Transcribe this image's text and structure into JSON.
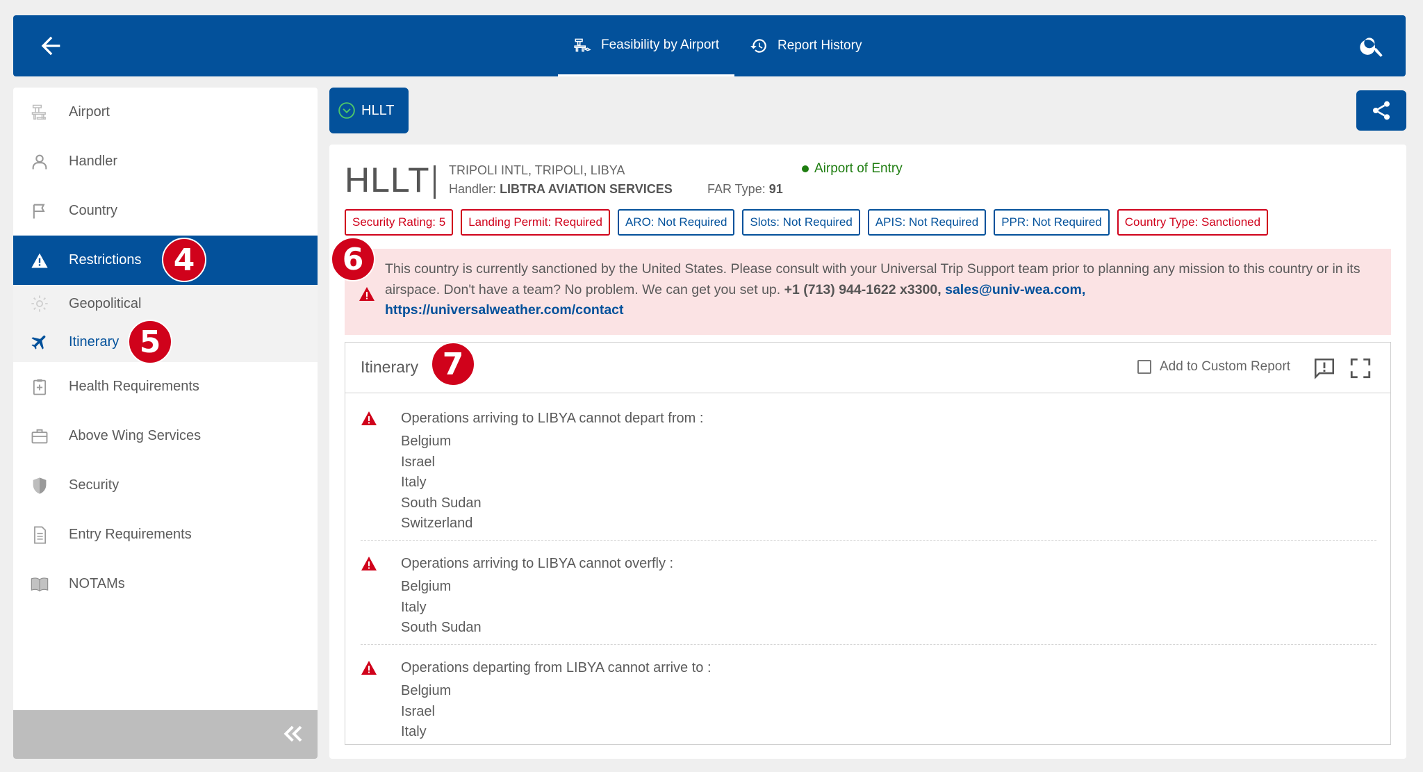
{
  "header": {
    "tabs": [
      {
        "label": "Feasibility by Airport",
        "icon": "airport-tower-icon",
        "active": true
      },
      {
        "label": "Report History",
        "icon": "history-icon",
        "active": false
      }
    ]
  },
  "sidebar": {
    "items": [
      {
        "label": "Airport",
        "icon": "airport-icon"
      },
      {
        "label": "Handler",
        "icon": "person-icon"
      },
      {
        "label": "Country",
        "icon": "flag-icon"
      },
      {
        "label": "Restrictions",
        "icon": "warning-icon",
        "active": true
      },
      {
        "label": "Geopolitical",
        "icon": "gear-icon"
      },
      {
        "label": "Itinerary",
        "icon": "airplane-icon",
        "selected": true
      },
      {
        "label": "Health Requirements",
        "icon": "clipboard-plus-icon"
      },
      {
        "label": "Above Wing Services",
        "icon": "briefcase-icon"
      },
      {
        "label": "Security",
        "icon": "shield-icon"
      },
      {
        "label": "Entry Requirements",
        "icon": "document-icon"
      },
      {
        "label": "NOTAMs",
        "icon": "book-icon"
      }
    ]
  },
  "markers": {
    "m4": "4",
    "m5": "5",
    "m6": "6",
    "m7": "7"
  },
  "airport_chip": {
    "label": "HLLT"
  },
  "airport": {
    "code": "HLLT",
    "name": "TRIPOLI INTL, TRIPOLI, LIBYA",
    "handler_label": "Handler:",
    "handler_value": "LIBTRA AVIATION SERVICES",
    "far_label": "FAR Type:",
    "far_value": "91",
    "entry_status": "Airport of Entry",
    "entry_color": "#1e7d10"
  },
  "badges": [
    {
      "label": "Security Rating: 5",
      "tone": "red"
    },
    {
      "label": "Landing Permit: Required",
      "tone": "red"
    },
    {
      "label": "ARO: Not Required",
      "tone": "blue"
    },
    {
      "label": "Slots: Not Required",
      "tone": "blue"
    },
    {
      "label": "APIS: Not Required",
      "tone": "blue"
    },
    {
      "label": "PPR: Not Required",
      "tone": "blue"
    },
    {
      "label": "Country Type: Sanctioned",
      "tone": "red"
    }
  ],
  "alert": {
    "text": "This country is currently sanctioned by the United States. Please consult with your Universal Trip Support team prior to planning any mission to this country or in its airspace. Don't have a team? No problem. We can get you set up.",
    "phone": "+1 (713) 944-1622 x3300,",
    "email": "sales@univ-wea.com,",
    "url": "https://universalweather.com/contact"
  },
  "itinerary": {
    "title": "Itinerary",
    "custom_report_label": "Add to Custom Report",
    "restrictions": [
      {
        "heading": "Operations arriving to LIBYA cannot depart from :",
        "countries": [
          "Belgium",
          "Israel",
          "Italy",
          "South Sudan",
          "Switzerland"
        ]
      },
      {
        "heading": "Operations arriving to LIBYA cannot overfly :",
        "countries": [
          "Belgium",
          "Italy",
          "South Sudan"
        ]
      },
      {
        "heading": "Operations departing from LIBYA cannot arrive to :",
        "countries": [
          "Belgium",
          "Israel",
          "Italy"
        ]
      }
    ]
  },
  "colors": {
    "primary": "#03519b",
    "danger": "#d0021b",
    "alert_bg": "#fbe3e4"
  }
}
